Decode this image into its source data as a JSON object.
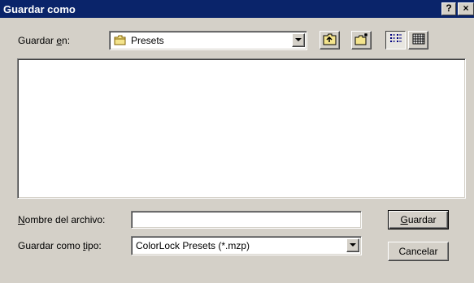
{
  "window": {
    "title": "Guardar como",
    "help_glyph": "?",
    "close_glyph": "×"
  },
  "location": {
    "label_prefix": "Guardar ",
    "label_accel": "e",
    "label_suffix": "n:",
    "folder": "Presets"
  },
  "toolbar": {
    "up_folder_icon": "up-folder-icon",
    "new_folder_icon": "new-folder-icon",
    "list_view_icon": "list-view-icon",
    "details_view_icon": "details-view-icon"
  },
  "filename": {
    "label_accel": "N",
    "label_rest": "ombre del archivo:",
    "value": ""
  },
  "filetype": {
    "label_prefix": "Guardar como ",
    "label_accel": "t",
    "label_suffix": "ipo:",
    "selected": "ColorLock Presets (*.mzp)"
  },
  "buttons": {
    "save_accel": "G",
    "save_rest": "uardar",
    "cancel": "Cancelar"
  },
  "colors": {
    "titlebar": "#0a246a",
    "face": "#d4d0c8"
  }
}
